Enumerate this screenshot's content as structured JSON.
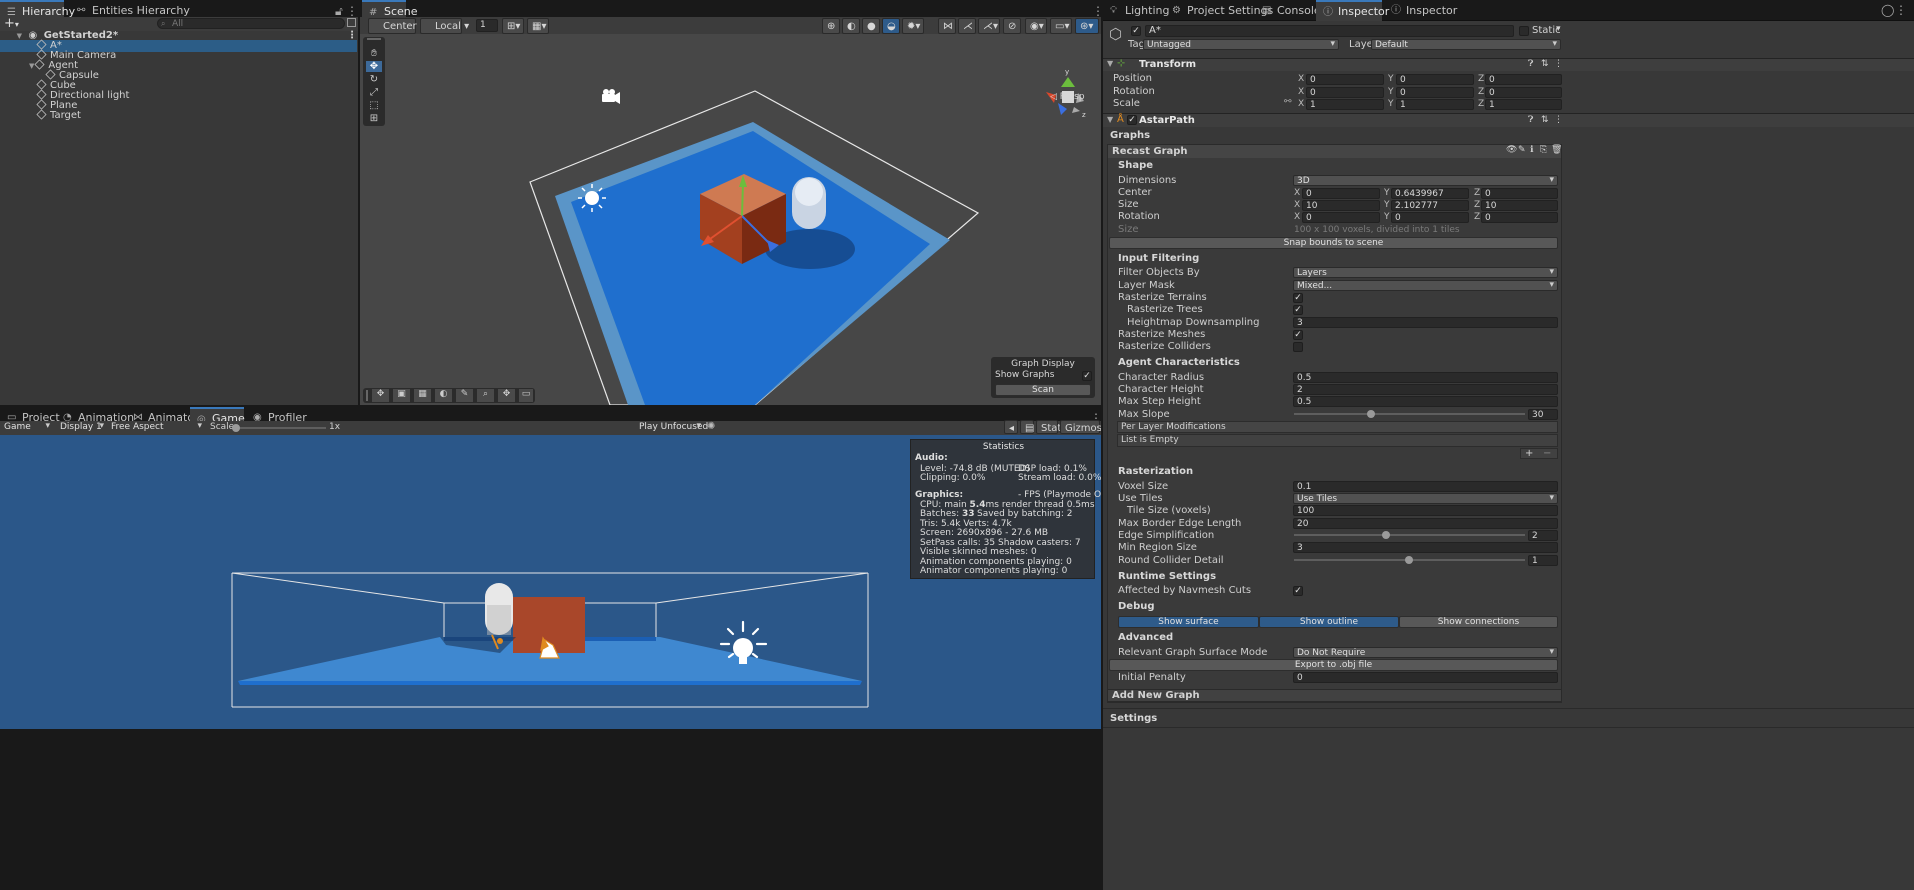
{
  "hierarchy": {
    "tabs": [
      {
        "label": "Hierarchy",
        "active": true
      },
      {
        "label": "Entities Hierarchy",
        "active": false
      }
    ],
    "search_placeholder": "All",
    "add_label": "+",
    "scene_name": "GetStarted2*",
    "items": [
      {
        "label": "A*",
        "indent": 1,
        "selected": true
      },
      {
        "label": "Main Camera",
        "indent": 1
      },
      {
        "label": "Agent",
        "indent": 1,
        "expanded": true
      },
      {
        "label": "Capsule",
        "indent": 2
      },
      {
        "label": "Cube",
        "indent": 1
      },
      {
        "label": "Directional light",
        "indent": 1
      },
      {
        "label": "Plane",
        "indent": 1
      },
      {
        "label": "Target",
        "indent": 1
      }
    ]
  },
  "scene": {
    "tab": "Scene",
    "pivot": "Center",
    "space": "Local",
    "grid_value": "1",
    "persp_label": "◁ Persp",
    "overlay": {
      "title": "Graph Display",
      "show_graphs_label": "Show Graphs",
      "show_graphs": true,
      "scan_label": "Scan"
    }
  },
  "game": {
    "tabs": [
      {
        "label": "Project"
      },
      {
        "label": "Animation"
      },
      {
        "label": "Animator"
      },
      {
        "label": "Game",
        "active": true
      },
      {
        "label": "Profiler"
      }
    ],
    "view_mode": "Game",
    "display": "Display 1",
    "aspect": "Free Aspect",
    "scale_label": "Scale",
    "scale_value": "1x",
    "play_mode": "Play Unfocused",
    "stats_label": "Stats",
    "gizmos_label": "Gizmos",
    "statistics": {
      "title": "Statistics",
      "audio_h": "Audio:",
      "level": "Level: -74.8 dB (MUTED)",
      "clipping": "Clipping: 0.0%",
      "dsp": "DSP load: 0.1%",
      "stream": "Stream load: 0.0%",
      "graphics_h": "Graphics:",
      "fps": "- FPS (Playmode Off",
      "cpu_prefix": "CPU: main ",
      "cpu_main": "5.4",
      "cpu_suffix": "ms  render thread 0.5ms",
      "batches_prefix": "Batches: ",
      "batches": "33",
      "saved": "Saved by batching: 2",
      "tris": "Tris: 5.4k   Verts: 4.7k",
      "screen": "Screen: 2690x896 - 27.6 MB",
      "setpass": "SetPass calls: 35",
      "shadow": "Shadow casters: 7",
      "skinned": "Visible skinned meshes: 0",
      "anim": "Animation components playing: 0",
      "animator": "Animator components playing: 0"
    }
  },
  "inspector": {
    "tabs": [
      {
        "label": "Lighting"
      },
      {
        "label": "Project Settings"
      },
      {
        "label": "Console"
      },
      {
        "label": "Inspector",
        "active": true
      },
      {
        "label": "Inspector"
      }
    ],
    "object_name": "A*",
    "static_label": "Static",
    "tag_label": "Tag",
    "tag_value": "Untagged",
    "layer_label": "Layer",
    "layer_value": "Default",
    "transform": {
      "title": "Transform",
      "position_label": "Position",
      "rotation_label": "Rotation",
      "scale_label": "Scale",
      "position": [
        "0",
        "0",
        "0"
      ],
      "rotation": [
        "0",
        "0",
        "0"
      ],
      "scale": [
        "1",
        "1",
        "1"
      ]
    },
    "astar": {
      "title": "AstarPath",
      "graphs_label": "Graphs",
      "recast_label": "Recast Graph",
      "shape_h": "Shape",
      "dimensions_label": "Dimensions",
      "dimensions_value": "3D",
      "center_label": "Center",
      "center": [
        "0",
        "0.6439967",
        "0"
      ],
      "size_label": "Size",
      "size": [
        "10",
        "2.102777",
        "10"
      ],
      "rotation_label": "Rotation",
      "rotation": [
        "0",
        "0",
        "0"
      ],
      "size_info_label": "Size",
      "size_info": "100 x 100 voxels, divided into 1 tiles",
      "snap_label": "Snap bounds to scene",
      "input_h": "Input Filtering",
      "filter_label": "Filter Objects By",
      "filter_value": "Layers",
      "layer_mask_label": "Layer Mask",
      "layer_mask_value": "Mixed...",
      "rast_terrains_label": "Rasterize Terrains",
      "rast_trees_label": "Rasterize Trees",
      "heightmap_label": "Heightmap Downsampling",
      "heightmap_value": "3",
      "rast_meshes_label": "Rasterize Meshes",
      "rast_colliders_label": "Rasterize Colliders",
      "agent_h": "Agent Characteristics",
      "char_radius_label": "Character Radius",
      "char_radius": "0.5",
      "char_height_label": "Character Height",
      "char_height": "2",
      "max_step_label": "Max Step Height",
      "max_step": "0.5",
      "max_slope_label": "Max Slope",
      "max_slope": "30",
      "per_layer_label": "Per Layer Modifications",
      "list_empty": "List is Empty",
      "rasterization_h": "Rasterization",
      "voxel_label": "Voxel Size",
      "voxel": "0.1",
      "use_tiles_label": "Use Tiles",
      "use_tiles": "Use Tiles",
      "tile_size_label": "Tile Size (voxels)",
      "tile_size": "100",
      "max_border_label": "Max Border Edge Length",
      "max_border": "20",
      "edge_simp_label": "Edge Simplification",
      "edge_simp": "2",
      "min_region_label": "Min Region Size",
      "min_region": "3",
      "round_collider_label": "Round Collider Detail",
      "round_collider": "1",
      "runtime_h": "Runtime Settings",
      "navmesh_cuts_label": "Affected by Navmesh Cuts",
      "debug_h": "Debug",
      "show_surface": "Show surface",
      "show_outline": "Show outline",
      "show_connections": "Show connections",
      "advanced_h": "Advanced",
      "relevant_label": "Relevant Graph Surface Mode",
      "relevant_value": "Do Not Require",
      "export_label": "Export to .obj file",
      "initial_penalty_label": "Initial Penalty",
      "initial_penalty": "0",
      "add_graph_label": "Add New Graph",
      "settings_label": "Settings"
    }
  },
  "colors": {
    "accent": "#3a79bb",
    "selection": "#2c5d87",
    "navmesh": "#1f6fce",
    "game_bg": "#2b5789",
    "cube": "#b5482a"
  }
}
